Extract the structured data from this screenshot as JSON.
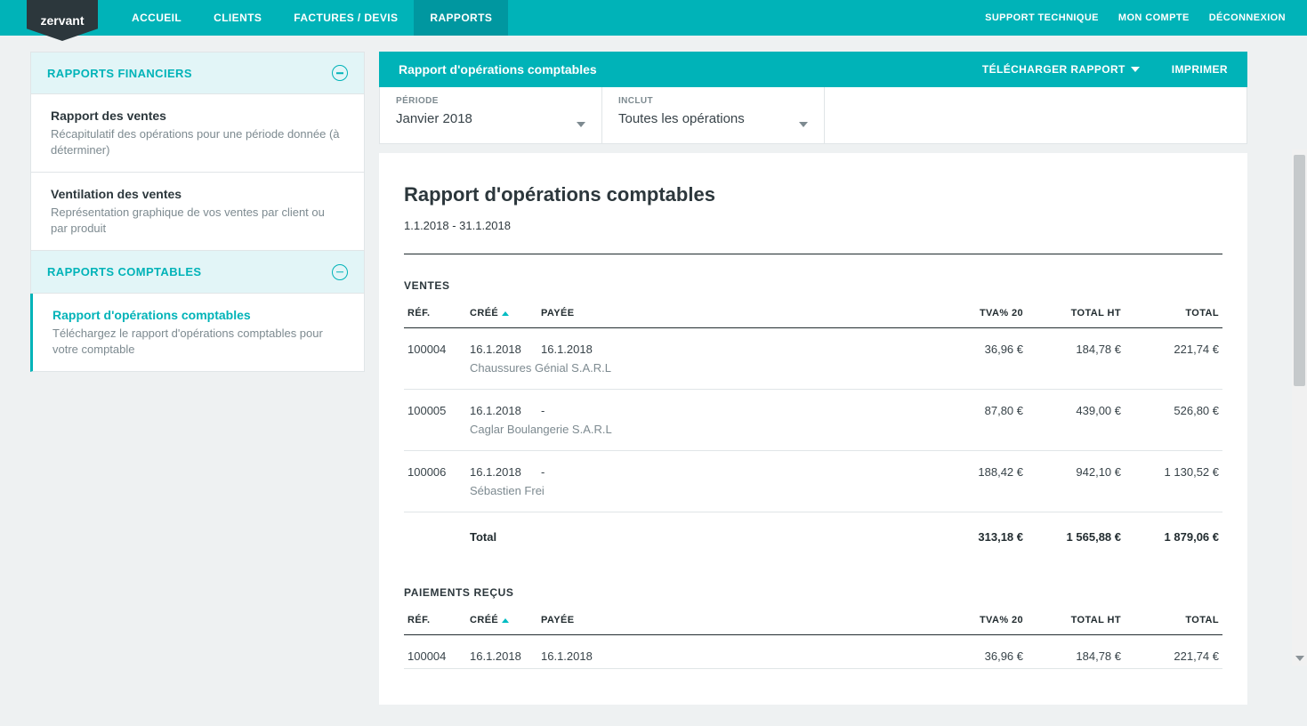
{
  "brand": "zervant",
  "topnav": {
    "items": [
      {
        "label": "ACCUEIL"
      },
      {
        "label": "CLIENTS"
      },
      {
        "label": "FACTURES / DEVIS"
      },
      {
        "label": "RAPPORTS"
      }
    ],
    "active_index": 3
  },
  "topright": {
    "support": "SUPPORT TECHNIQUE",
    "account": "MON COMPTE",
    "logout": "DÉCONNEXION"
  },
  "sidebar": {
    "section1_title": "RAPPORTS FINANCIERS",
    "section2_title": "RAPPORTS COMPTABLES",
    "items1": [
      {
        "title": "Rapport des ventes",
        "desc": "Récapitulatif des opérations pour une période donnée (à déterminer)"
      },
      {
        "title": "Ventilation des ventes",
        "desc": "Représentation graphique de vos ventes par client ou par produit"
      }
    ],
    "items2": [
      {
        "title": "Rapport d'opérations comptables",
        "desc": "Téléchargez le rapport d'opérations comptables pour votre comptable"
      }
    ]
  },
  "main_header": {
    "title": "Rapport d'opérations comptables",
    "download": "TÉLÉCHARGER RAPPORT",
    "print": "IMPRIMER"
  },
  "filters": {
    "period_label": "PÉRIODE",
    "period_value": "Janvier 2018",
    "include_label": "INCLUT",
    "include_value": "Toutes les opérations"
  },
  "report": {
    "title": "Rapport d'opérations comptables",
    "date_range": "1.1.2018 - 31.1.2018",
    "groups": [
      {
        "name": "VENTES",
        "columns": {
          "ref": "RÉF.",
          "created": "CRÉÉ",
          "paid": "PAYÉE",
          "vat": "TVA% 20",
          "ht": "TOTAL HT",
          "total": "TOTAL"
        },
        "rows": [
          {
            "ref": "100004",
            "created": "16.1.2018",
            "paid": "16.1.2018",
            "client": "Chaussures Génial S.A.R.L",
            "vat": "36,96 €",
            "ht": "184,78 €",
            "total": "221,74 €"
          },
          {
            "ref": "100005",
            "created": "16.1.2018",
            "paid": "-",
            "client": "Caglar Boulangerie S.A.R.L",
            "vat": "87,80 €",
            "ht": "439,00 €",
            "total": "526,80 €"
          },
          {
            "ref": "100006",
            "created": "16.1.2018",
            "paid": "-",
            "client": "Sébastien Frei",
            "vat": "188,42 €",
            "ht": "942,10 €",
            "total": "1 130,52 €"
          }
        ],
        "total_label": "Total",
        "totals": {
          "vat": "313,18 €",
          "ht": "1 565,88 €",
          "total": "1 879,06 €"
        }
      },
      {
        "name": "PAIEMENTS REÇUS",
        "columns": {
          "ref": "RÉF.",
          "created": "CRÉÉ",
          "paid": "PAYÉE",
          "vat": "TVA% 20",
          "ht": "TOTAL HT",
          "total": "TOTAL"
        },
        "rows": [
          {
            "ref": "100004",
            "created": "16.1.2018",
            "paid": "16.1.2018",
            "client": "",
            "vat": "36,96 €",
            "ht": "184,78 €",
            "total": "221,74 €"
          }
        ]
      }
    ]
  }
}
